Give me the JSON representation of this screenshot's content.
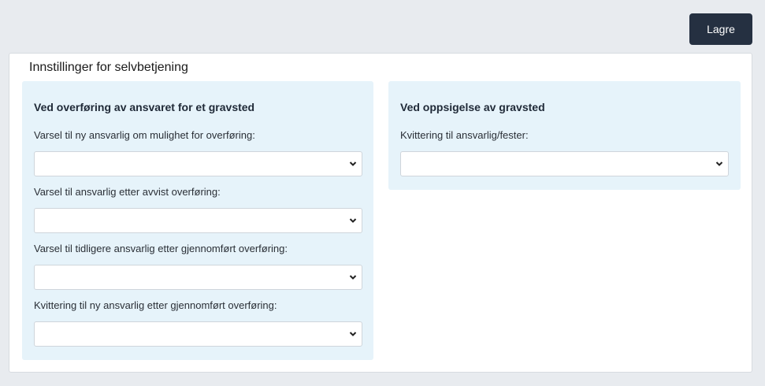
{
  "toolbar": {
    "save_label": "Lagre"
  },
  "settings": {
    "title": "Innstillinger for selvbetjening",
    "transfer": {
      "heading": "Ved overføring av ansvaret for et gravsted",
      "fields": [
        {
          "label": "Varsel til ny ansvarlig om mulighet for overføring:",
          "value": ""
        },
        {
          "label": "Varsel til ansvarlig etter avvist overføring:",
          "value": ""
        },
        {
          "label": "Varsel til tidligere ansvarlig etter gjennomført overføring:",
          "value": ""
        },
        {
          "label": "Kvittering til ny ansvarlig etter gjennomført overføring:",
          "value": ""
        }
      ]
    },
    "termination": {
      "heading": "Ved oppsigelse av gravsted",
      "fields": [
        {
          "label": "Kvittering til ansvarlig/fester:",
          "value": ""
        }
      ]
    }
  },
  "icons": {
    "dropdown": "chevron-down-icon"
  }
}
